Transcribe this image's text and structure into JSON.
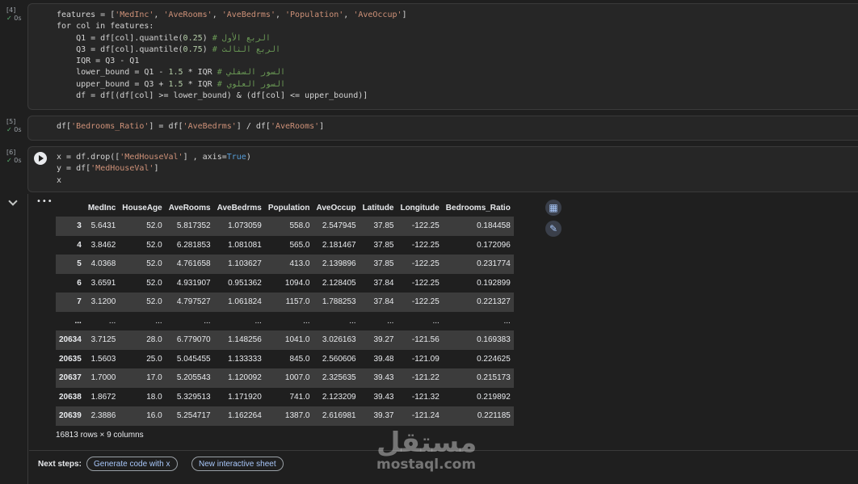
{
  "cells": [
    {
      "exec": "[4]",
      "time": "0s"
    },
    {
      "exec": "[5]",
      "time": "0s"
    },
    {
      "exec": "[6]",
      "time": "0s"
    }
  ],
  "code4": {
    "l1a": "features = [",
    "l1s1": "'MedInc'",
    "l1s2": "'AveRooms'",
    "l1s3": "'AveBedrms'",
    "l1s4": "'Population'",
    "l1s5": "'AveOccup'",
    "l2": "for col in features:",
    "l3a": "    Q1 = df[col].quantile(",
    "l3n": "0.25",
    "l3c": "# الربع الأول",
    "l4a": "    Q3 = df[col].quantile(",
    "l4n": "0.75",
    "l4c": "# الربع الثالث",
    "l5": "    IQR = Q3 - Q1",
    "l6a": "    lower_bound = Q1 - ",
    "l6n1": "1.5",
    "l6b": " * IQR ",
    "l6c": "# السور السفلي",
    "l7a": "    upper_bound = Q3 + ",
    "l7n1": "1.5",
    "l7b": " * IQR ",
    "l7c": "# السور العلوي",
    "l8": "    df = df[(df[col] >= lower_bound) & (df[col] <= upper_bound)]"
  },
  "code5": {
    "a": "df[",
    "s1": "'Bedrooms_Ratio'",
    "b": "] = df[",
    "s2": "'AveBedrms'",
    "c": "] / df[",
    "s3": "'AveRooms'",
    "d": "]"
  },
  "code6": {
    "l1a": "x = df.drop([",
    "l1s": "'MedHouseVal'",
    "l1b": "] , axis=",
    "l1k": "True",
    "l1c": ")",
    "l2a": "y = df[",
    "l2s": "'MedHouseVal'",
    "l2b": "]",
    "l3": "x"
  },
  "table": {
    "columns": [
      "",
      "MedInc",
      "HouseAge",
      "AveRooms",
      "AveBedrms",
      "Population",
      "AveOccup",
      "Latitude",
      "Longitude",
      "Bedrooms_Ratio"
    ],
    "rows": [
      [
        "3",
        "5.6431",
        "52.0",
        "5.817352",
        "1.073059",
        "558.0",
        "2.547945",
        "37.85",
        "-122.25",
        "0.184458"
      ],
      [
        "4",
        "3.8462",
        "52.0",
        "6.281853",
        "1.081081",
        "565.0",
        "2.181467",
        "37.85",
        "-122.25",
        "0.172096"
      ],
      [
        "5",
        "4.0368",
        "52.0",
        "4.761658",
        "1.103627",
        "413.0",
        "2.139896",
        "37.85",
        "-122.25",
        "0.231774"
      ],
      [
        "6",
        "3.6591",
        "52.0",
        "4.931907",
        "0.951362",
        "1094.0",
        "2.128405",
        "37.84",
        "-122.25",
        "0.192899"
      ],
      [
        "7",
        "3.1200",
        "52.0",
        "4.797527",
        "1.061824",
        "1157.0",
        "1.788253",
        "37.84",
        "-122.25",
        "0.221327"
      ],
      [
        "...",
        "...",
        "...",
        "...",
        "...",
        "...",
        "...",
        "...",
        "...",
        "..."
      ],
      [
        "20634",
        "3.7125",
        "28.0",
        "6.779070",
        "1.148256",
        "1041.0",
        "3.026163",
        "39.27",
        "-121.56",
        "0.169383"
      ],
      [
        "20635",
        "1.5603",
        "25.0",
        "5.045455",
        "1.133333",
        "845.0",
        "2.560606",
        "39.48",
        "-121.09",
        "0.224625"
      ],
      [
        "20637",
        "1.7000",
        "17.0",
        "5.205543",
        "1.120092",
        "1007.0",
        "2.325635",
        "39.43",
        "-121.22",
        "0.215173"
      ],
      [
        "20638",
        "1.8672",
        "18.0",
        "5.329513",
        "1.171920",
        "741.0",
        "2.123209",
        "39.43",
        "-121.32",
        "0.219892"
      ],
      [
        "20639",
        "2.3886",
        "16.0",
        "5.254717",
        "1.162264",
        "1387.0",
        "2.616981",
        "39.37",
        "-121.24",
        "0.221185"
      ]
    ]
  },
  "output": {
    "dots": "•••",
    "rows_info": "16813 rows × 9 columns"
  },
  "next_steps": {
    "label": "Next steps:",
    "chip1": "Generate code with x",
    "chip2": "New interactive sheet"
  },
  "icons": {
    "run": "play-icon",
    "check": "check-icon",
    "table": "table-icon",
    "magic": "magic-wand-icon",
    "collapse": "chevron-down-icon"
  },
  "watermark": {
    "arabic": "مستقل",
    "latin": "mostaql.com"
  }
}
